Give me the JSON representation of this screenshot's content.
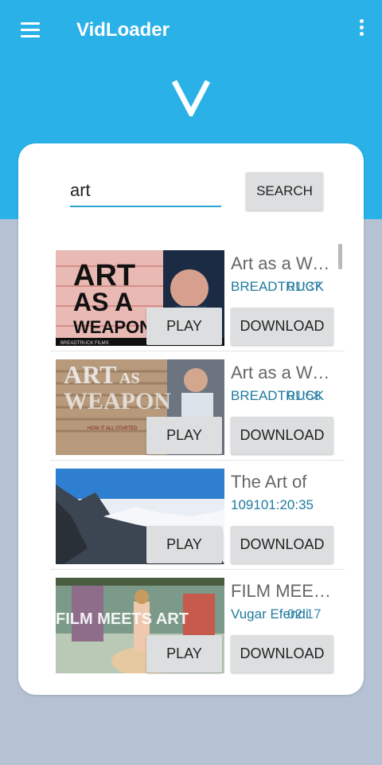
{
  "app": {
    "title": "VidLoader",
    "logo_letter": "V",
    "primary_color": "#29b1e8"
  },
  "search": {
    "value": "art",
    "button_label": "SEARCH"
  },
  "videos": [
    {
      "title": "Art as a Weapon",
      "subtitle": "BREADTRUCK",
      "duration": "01:37",
      "play_label": "PLAY",
      "download_label": "DOWNLOAD"
    },
    {
      "title": "Art as a Weapon",
      "subtitle": "BREADTRUCK",
      "duration": "01:58",
      "play_label": "PLAY",
      "download_label": "DOWNLOAD"
    },
    {
      "title": "The Art of",
      "subtitle": "109101:20:35",
      "duration": "",
      "play_label": "PLAY",
      "download_label": "DOWNLOAD"
    },
    {
      "title": "FILM MEETS ART",
      "subtitle": "Vugar Efendi",
      "duration": "02:17",
      "play_label": "PLAY",
      "download_label": "DOWNLOAD"
    }
  ],
  "thumbnails": [
    {
      "text_lines": [
        "ART",
        "AS A",
        "WEAPON"
      ],
      "caption": "BREADTRUCK FILMS"
    },
    {
      "text_lines": [
        "ART",
        "AS",
        "WEAPON"
      ],
      "caption": "HOW IT ALL STARTED"
    },
    {
      "text_lines": []
    },
    {
      "text_lines": [
        "FILM MEETS ART"
      ]
    }
  ],
  "icons": {
    "menu": "hamburger-icon",
    "more": "more-vert-icon",
    "logo": "v-logo-icon"
  }
}
